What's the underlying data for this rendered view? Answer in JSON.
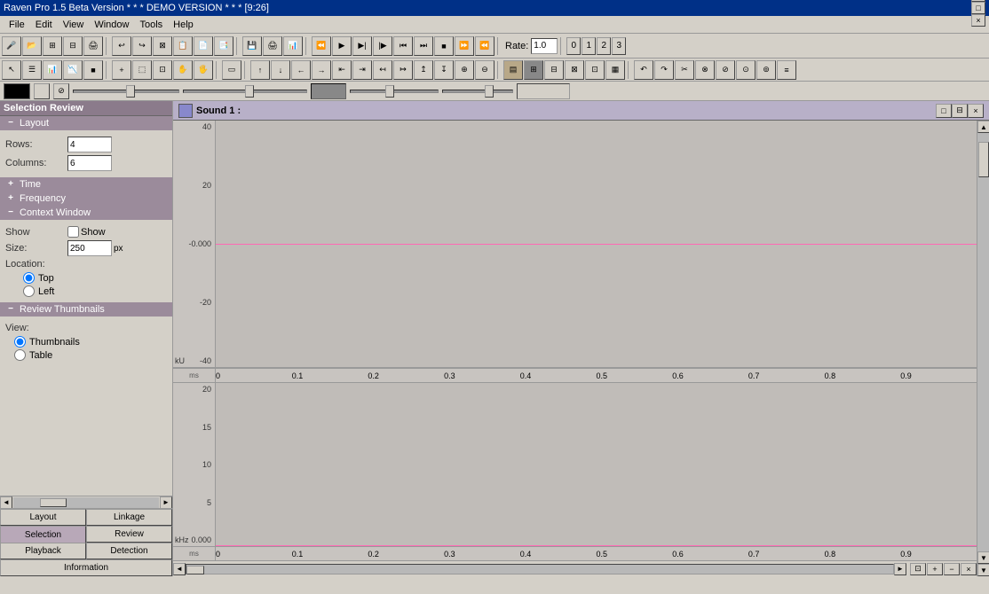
{
  "title_bar": {
    "title": "Raven Pro 1.5 Beta Version  * * * DEMO VERSION * * *  [9:26]",
    "controls": [
      "_",
      "□",
      "×"
    ]
  },
  "menu": {
    "items": [
      "File",
      "Edit",
      "View",
      "Window",
      "Tools",
      "Help"
    ]
  },
  "toolbar1": {
    "rate_label": "Rate:",
    "rate_value": "1.0",
    "numbers": [
      "0",
      "1",
      "2",
      "3"
    ]
  },
  "left_panel": {
    "title": "Selection Review",
    "layout": {
      "label": "Layout",
      "rows_label": "Rows:",
      "rows_value": "4",
      "cols_label": "Columns:",
      "cols_value": "6"
    },
    "time": {
      "label": "Time"
    },
    "frequency": {
      "label": "Frequency"
    },
    "context_window": {
      "label": "Context Window",
      "show_label": "Show",
      "size_label": "Size:",
      "size_value": "250",
      "size_unit": "px",
      "location_label": "Location:",
      "top_label": "Top",
      "left_label": "Left"
    },
    "review_thumbnails": {
      "label": "Review Thumbnails",
      "view_label": "View:",
      "thumbnails_label": "Thumbnails",
      "table_label": "Table"
    }
  },
  "bottom_tabs": {
    "tabs": [
      "Layout",
      "Linkage",
      "Selection",
      "Review",
      "Playback",
      "Detection",
      "Information"
    ]
  },
  "sound_window": {
    "title": "Sound 1 :",
    "waveform": {
      "y_labels": [
        "40",
        "20",
        "-0.000",
        "-20",
        "-40"
      ],
      "y_unit": "kU",
      "x_labels": [
        "ms 0",
        "0.1",
        "0.2",
        "0.3",
        "0.4",
        "0.5",
        "0.6",
        "0.7",
        "0.8",
        "0.9"
      ],
      "pink_line_value": "-0.000"
    },
    "spectrogram": {
      "y_labels": [
        "20",
        "15",
        "10",
        "5",
        "0.000"
      ],
      "y_unit": "kHz",
      "x_labels": [
        "ms 0",
        "0.1",
        "0.2",
        "0.3",
        "0.4",
        "0.5",
        "0.6",
        "0.7",
        "0.8",
        "0.9"
      ]
    }
  },
  "icons": {
    "mic": "🎤",
    "folder": "📁",
    "save": "💾",
    "play": "▶",
    "stop": "■",
    "zoom_in": "+",
    "zoom_out": "-",
    "arrow_up": "▲",
    "arrow_down": "▼",
    "arrow_left": "◄",
    "arrow_right": "►",
    "minimize": "_",
    "maximize": "□",
    "close": "×"
  }
}
